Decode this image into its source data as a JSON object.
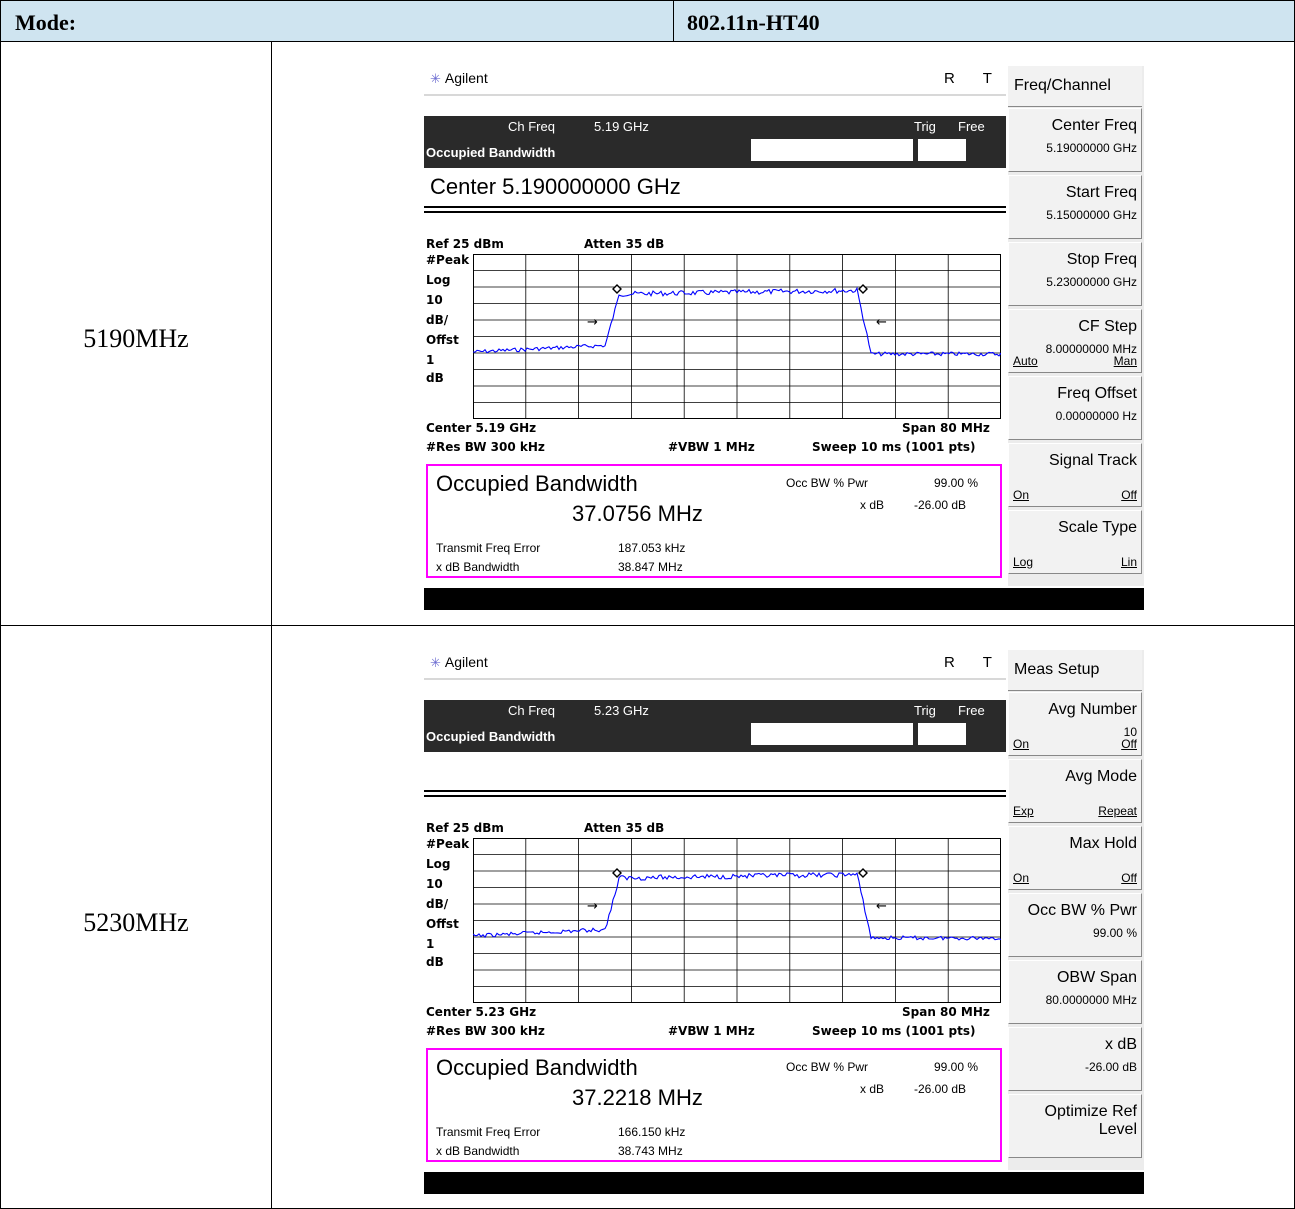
{
  "header": {
    "mode_label": "Mode:",
    "mode_value": "802.11n-HT40"
  },
  "rows": [
    {
      "freq_label": "5190MHz",
      "screen": {
        "brand": "Agilent",
        "status": "R  T",
        "ch_freq_label": "Ch Freq",
        "ch_freq_value": "5.19 GHz",
        "trig_label": "Trig",
        "trig_value": "Free",
        "meas_name": "Occupied Bandwidth",
        "center_line": "Center 5.190000000 GHz",
        "ref": "Ref 25 dBm",
        "atten": "Atten 35 dB",
        "scale_labels": [
          "#Peak",
          "Log",
          "10",
          "dB/",
          "Offst",
          "1",
          "dB"
        ],
        "center_short": "Center 5.19 GHz",
        "span": "Span 80 MHz",
        "res_bw": "#Res BW 300 kHz",
        "vbw": "#VBW 1 MHz",
        "sweep": "Sweep 10 ms (1001 pts)",
        "result_title": "Occupied Bandwidth",
        "result_value": "37.0756 MHz",
        "occ_label": "Occ BW % Pwr",
        "occ_value": "99.00 %",
        "xdb_label": "x dB",
        "xdb_value": "-26.00 dB",
        "tfe_label": "Transmit Freq Error",
        "tfe_value": "187.053 kHz",
        "xdbbw_label": "x dB Bandwidth",
        "xdbbw_value": "38.847 MHz"
      },
      "softkeys": {
        "title": "Freq/Channel",
        "keys": [
          {
            "name": "Center Freq",
            "value": "5.19000000 GHz"
          },
          {
            "name": "Start Freq",
            "value": "5.15000000 GHz"
          },
          {
            "name": "Stop Freq",
            "value": "5.23000000 GHz"
          },
          {
            "name": "CF Step",
            "value": "8.00000000 MHz",
            "left": "Auto",
            "right": "Man"
          },
          {
            "name": "Freq Offset",
            "value": "0.00000000  Hz"
          },
          {
            "name": "Signal Track",
            "left": "On",
            "right": "Off"
          },
          {
            "name": "Scale Type",
            "left": "Log",
            "right": "Lin"
          }
        ]
      }
    },
    {
      "freq_label": "5230MHz",
      "screen": {
        "brand": "Agilent",
        "status": "R  T",
        "ch_freq_label": "Ch Freq",
        "ch_freq_value": "5.23 GHz",
        "trig_label": "Trig",
        "trig_value": "Free",
        "meas_name": "Occupied Bandwidth",
        "center_line": "",
        "ref": "Ref 25 dBm",
        "atten": "Atten 35 dB",
        "scale_labels": [
          "#Peak",
          "Log",
          "10",
          "dB/",
          "Offst",
          "1",
          "dB"
        ],
        "center_short": "Center 5.23 GHz",
        "span": "Span 80 MHz",
        "res_bw": "#Res BW 300 kHz",
        "vbw": "#VBW 1 MHz",
        "sweep": "Sweep 10 ms (1001 pts)",
        "result_title": "Occupied Bandwidth",
        "result_value": "37.2218 MHz",
        "occ_label": "Occ BW % Pwr",
        "occ_value": "99.00 %",
        "xdb_label": "x dB",
        "xdb_value": "-26.00 dB",
        "tfe_label": "Transmit Freq Error",
        "tfe_value": "166.150 kHz",
        "xdbbw_label": "x dB Bandwidth",
        "xdbbw_value": "38.743 MHz"
      },
      "softkeys": {
        "title": "Meas Setup",
        "keys": [
          {
            "name": "Avg Number",
            "value": "10",
            "left": "On",
            "right": "Off"
          },
          {
            "name": "Avg Mode",
            "left": "Exp",
            "right": "Repeat"
          },
          {
            "name": "Max Hold",
            "left": "On",
            "right": "Off"
          },
          {
            "name": "Occ BW % Pwr",
            "value": "99.00 %"
          },
          {
            "name": "OBW Span",
            "value": "80.0000000 MHz"
          },
          {
            "name": "x dB",
            "value": "-26.00 dB"
          },
          {
            "name": "Optimize Ref Level"
          }
        ]
      }
    }
  ],
  "colors": {
    "trace": "#0000ff",
    "result_border": "#ff00ff",
    "header_bg": "#cfe4f0"
  }
}
